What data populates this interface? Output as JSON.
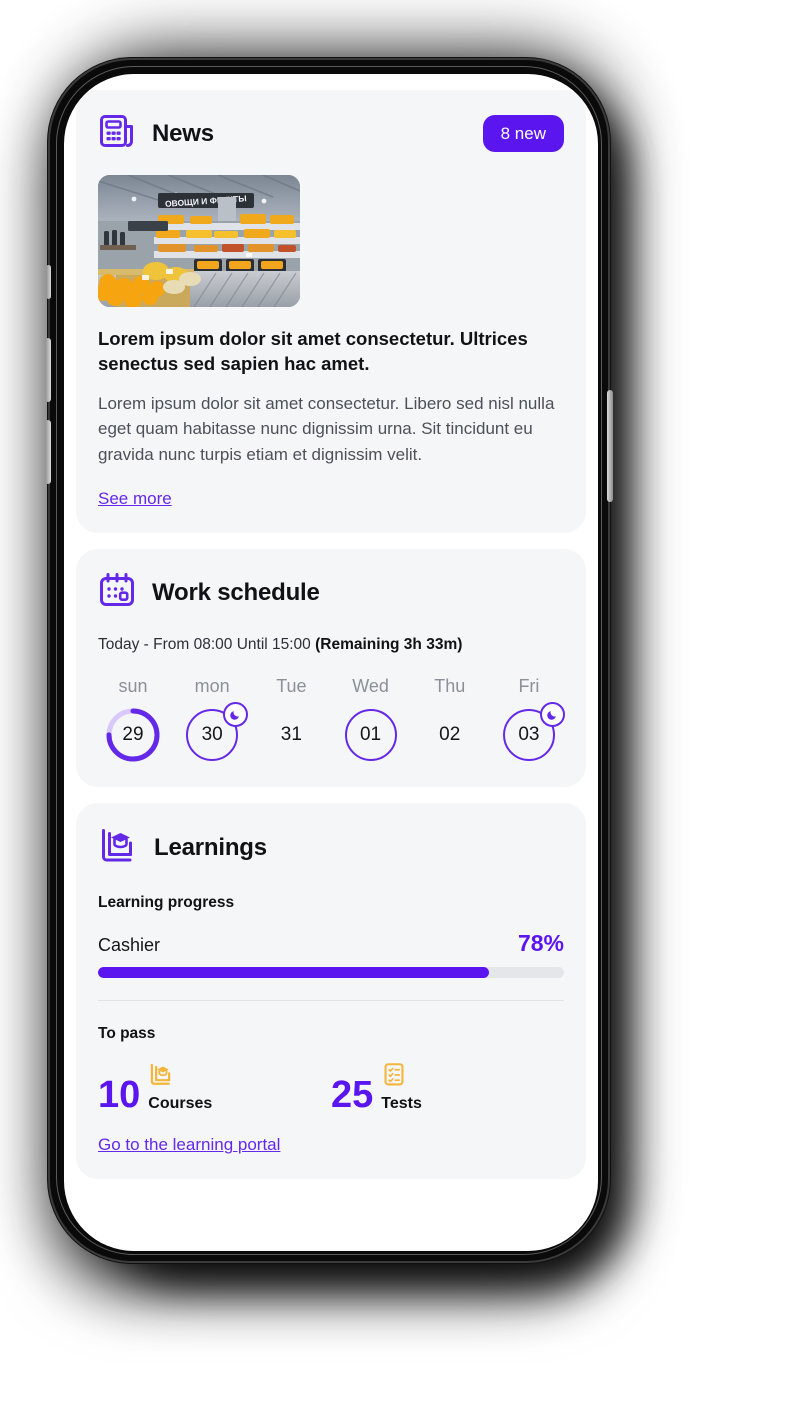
{
  "theme": {
    "accent": "#5B16F0",
    "accent_link": "#6429E8",
    "accent_soft": "#D9C8FB",
    "amber": "#F5B53A",
    "card_bg": "#F5F6F8",
    "screen_bg": "#FFFFFF",
    "text_primary": "#111215",
    "text_muted": "#8B9099"
  },
  "news": {
    "icon": "newspaper-icon",
    "title": "News",
    "badge": "8 new",
    "image_alt": "grocery store produce aisle",
    "image_sign_text": "ОВОЩИ И ФРУКТЫ",
    "headline": "Lorem ipsum dolor sit amet consectetur. Ultrices senectus sed sapien hac amet.",
    "body": "Lorem ipsum dolor sit amet consectetur. Libero sed nisl nulla eget quam habitasse nunc dignissim urna. Sit tincidunt eu gravida nunc turpis etiam et dignissim velit.",
    "link": "See more"
  },
  "schedule": {
    "icon": "calendar-icon",
    "title": "Work schedule",
    "summary_plain": "Today - From 08:00 Until 15:00 ",
    "summary_bold": "(Remaining 3h 33m)",
    "days": [
      {
        "name": "sun",
        "num": "29",
        "ring": "progress",
        "progress": 75,
        "moon": false
      },
      {
        "name": "mon",
        "num": "30",
        "ring": "outline",
        "progress": 0,
        "moon": true
      },
      {
        "name": "Tue",
        "num": "31",
        "ring": "none",
        "progress": 0,
        "moon": false
      },
      {
        "name": "Wed",
        "num": "01",
        "ring": "outline",
        "progress": 0,
        "moon": false
      },
      {
        "name": "Thu",
        "num": "02",
        "ring": "none",
        "progress": 0,
        "moon": false
      },
      {
        "name": "Fri",
        "num": "03",
        "ring": "outline",
        "progress": 0,
        "moon": true
      }
    ]
  },
  "learnings": {
    "icon": "book-graduation-icon",
    "title": "Learnings",
    "progress_label": "Learning progress",
    "course_name": "Cashier",
    "course_percent": "78%",
    "course_percent_value": 78,
    "to_pass_label": "To pass",
    "stats": [
      {
        "num": "10",
        "label": "Courses",
        "icon": "book-graduation-icon"
      },
      {
        "num": "25",
        "label": "Tests",
        "icon": "clipboard-check-icon"
      }
    ],
    "link": "Go to the learning portal"
  }
}
